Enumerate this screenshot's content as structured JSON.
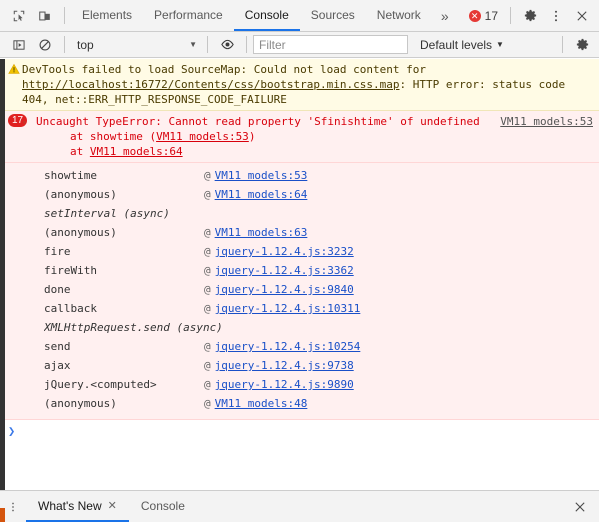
{
  "toolbar": {
    "inspect_icon": "inspect-element-icon",
    "device_icon": "device-toolbar-icon",
    "tabs": [
      {
        "label": "Elements",
        "active": false
      },
      {
        "label": "Performance",
        "active": false
      },
      {
        "label": "Console",
        "active": true
      },
      {
        "label": "Sources",
        "active": false
      },
      {
        "label": "Network",
        "active": false
      }
    ],
    "more_tabs": "»",
    "error_count": "17",
    "error_glyph": "✕",
    "settings_icon": "gear-icon",
    "menu_icon": "kebab-menu-icon",
    "close_icon": "close-icon"
  },
  "filterbar": {
    "sidebar_icon": "console-sidebar-icon",
    "clear_icon": "clear-console-icon",
    "context": "top",
    "context_caret": "▼",
    "eye_icon": "live-expression-icon",
    "filter_placeholder": "Filter",
    "filter_value": "",
    "levels_label": "Default levels",
    "levels_caret": "▼",
    "settings_icon": "console-settings-gear-icon"
  },
  "messages": {
    "warning": {
      "icon": "warning-triangle-icon",
      "part1": "DevTools failed to load SourceMap: Could not load content for ",
      "link": "http://localhost:16772/Contents/css/bootstrap.min.css.map",
      "part2": ": HTTP error: status code 404, net::ERR_HTTP_RESPONSE_CODE_FAILURE"
    },
    "error": {
      "badge": "17",
      "disclosure": "▾",
      "title": "Uncaught TypeError: Cannot read property 'Sfinishtime' of undefined",
      "source_link": "VM11 models:53",
      "at_lines": [
        {
          "prefix": "    at showtime (",
          "link": "VM11 models:53",
          "suffix": ")"
        },
        {
          "prefix": "    at ",
          "link": "VM11 models:64",
          "suffix": ""
        }
      ],
      "frames": [
        {
          "fn": "showtime",
          "at": "@",
          "loc": "VM11 models:53",
          "async": false
        },
        {
          "fn": "(anonymous)",
          "at": "@",
          "loc": "VM11 models:64",
          "async": false
        },
        {
          "fn": "setInterval (async)",
          "at": "",
          "loc": "",
          "async": true
        },
        {
          "fn": "(anonymous)",
          "at": "@",
          "loc": "VM11 models:63",
          "async": false
        },
        {
          "fn": "fire",
          "at": "@",
          "loc": "jquery-1.12.4.js:3232",
          "async": false
        },
        {
          "fn": "fireWith",
          "at": "@",
          "loc": "jquery-1.12.4.js:3362",
          "async": false
        },
        {
          "fn": "done",
          "at": "@",
          "loc": "jquery-1.12.4.js:9840",
          "async": false
        },
        {
          "fn": "callback",
          "at": "@",
          "loc": "jquery-1.12.4.js:10311",
          "async": false
        },
        {
          "fn": "XMLHttpRequest.send (async)",
          "at": "",
          "loc": "",
          "async": true
        },
        {
          "fn": "send",
          "at": "@",
          "loc": "jquery-1.12.4.js:10254",
          "async": false
        },
        {
          "fn": "ajax",
          "at": "@",
          "loc": "jquery-1.12.4.js:9738",
          "async": false
        },
        {
          "fn": "jQuery.<computed>",
          "at": "@",
          "loc": "jquery-1.12.4.js:9890",
          "async": false
        },
        {
          "fn": "(anonymous)",
          "at": "@",
          "loc": "VM11 models:48",
          "async": false
        }
      ]
    }
  },
  "prompt": {
    "chevron": "❯",
    "value": ""
  },
  "drawer": {
    "kebab_icon": "drawer-menu-icon",
    "tabs": [
      {
        "label": "What's New",
        "active": true,
        "closable": true,
        "close_glyph": "✕"
      },
      {
        "label": "Console",
        "active": false,
        "closable": false,
        "close_glyph": ""
      }
    ],
    "close_icon": "close-drawer-icon",
    "close_glyph": "✕"
  },
  "colors": {
    "accent": "#1a73e8",
    "error": "#d8000c",
    "error_badge": "#e02020",
    "warn_bg": "#fffbe5",
    "error_bg": "#fff0f0",
    "link": "#1a50c8",
    "toolbar_bg": "#f3f3f3"
  }
}
